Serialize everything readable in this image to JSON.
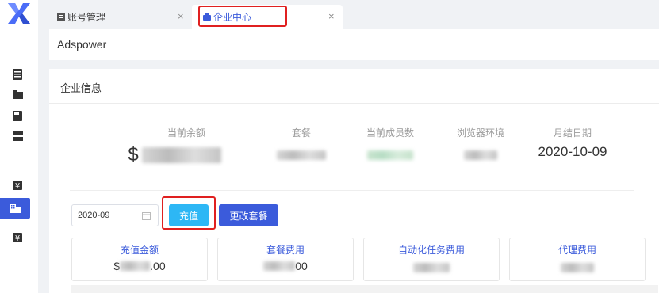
{
  "tabs": [
    {
      "label": "账号管理"
    },
    {
      "label": "企业中心"
    }
  ],
  "header": {
    "title": "Adspower"
  },
  "card": {
    "title": "企业信息"
  },
  "stats": [
    {
      "label": "当前余额",
      "prefix": "$"
    },
    {
      "label": "套餐"
    },
    {
      "label": "当前成员数"
    },
    {
      "label": "浏览器环境"
    },
    {
      "label": "月结日期",
      "value": "2020-10-09"
    }
  ],
  "controls": {
    "date_value": "2020-09",
    "recharge_label": "充值",
    "change_plan_label": "更改套餐"
  },
  "summaries": [
    {
      "label": "充值金额",
      "prefix": "$",
      "suffix": ".00"
    },
    {
      "label": "套餐费用",
      "suffix": "00"
    },
    {
      "label": "自动化任务费用"
    },
    {
      "label": "代理费用"
    }
  ],
  "colors": {
    "primary": "#3b5bdb",
    "recharge": "#2db7f5",
    "highlight": "#e02020"
  },
  "icons": [
    "logo-x-icon",
    "note-icon",
    "folder-icon",
    "save-icon",
    "server-icon",
    "yen-icon",
    "enterprise-icon",
    "yen-icon-2"
  ]
}
